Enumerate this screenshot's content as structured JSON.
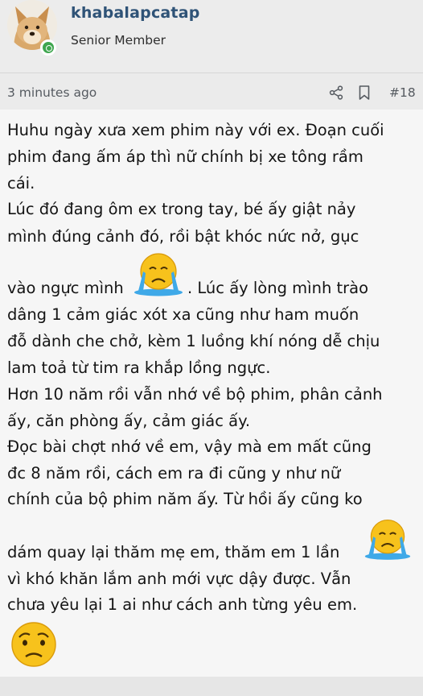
{
  "post": {
    "username": "khabalapcatap",
    "user_title": "Senior Member",
    "timestamp": "3 minutes ago",
    "post_number": "#18",
    "lines": [
      "Huhu ngày xưa xem phim này với ex. Đoạn cuối",
      "phim đang ấm áp thì nữ chính bị xe tông rầm",
      "cái.",
      "Lúc đó đang ôm ex trong tay, bé ấy giật nảy",
      "mình đúng cảnh đó, rồi bật khóc nức nở, gục",
      "vào ngực mình",
      ". Lúc ấy lòng mình trào",
      "dâng 1 cảm giác xót xa cũng như ham muốn",
      "đỗ dành che chở, kèm 1 luồng khí nóng dễ chịu",
      "lam toả từ tim ra khắp lồng ngực.",
      "Hơn 10 năm rồi vẫn nhớ về bộ phim, phân cảnh",
      "ấy, căn phòng ấy, cảm giác ấy.",
      "Đọc bài chợt nhớ về em, vậy mà em mất cũng",
      "đc 8 năm rồi, cách em ra đi cũng y như nữ",
      "chính của bộ phim năm ấy. Từ hồi ấy cũng ko",
      "dám quay lại thăm mẹ em, thăm em 1 lần",
      "vì khó khăn lắm anh mới vực dậy được. Vẫn",
      "chưa yêu lại 1 ai như cách anh từng yêu em."
    ]
  },
  "icons": {
    "share": "share-icon",
    "bookmark": "bookmark-icon",
    "emoji_crying": "crying-emoji-icon",
    "emoji_sad": "sad-emoji-icon",
    "online": "online-status-icon"
  },
  "colors": {
    "username": "#2f5377",
    "online": "#3fa64f",
    "emoji_yellow": "#f7c21c"
  }
}
